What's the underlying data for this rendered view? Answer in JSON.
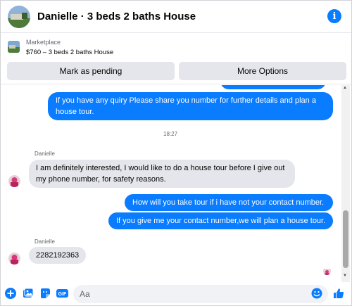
{
  "header": {
    "title": "Danielle · 3 beds 2 baths House",
    "info_icon": "info-icon"
  },
  "marketplace": {
    "label": "Marketplace",
    "item": "$760 – 3 beds 2 baths House",
    "buttons": {
      "pending": "Mark as pending",
      "more": "More Options"
    }
  },
  "messages": {
    "out_1": "If you have any quiry Please share you number for further details and plan a house tour.",
    "timestamp": "18:27",
    "sender_1": "Danielle",
    "in_1": "I am definitely interested, I would like to do a house tour before I give out my phone number, for safety reasons.",
    "out_2": "How will you take tour if i have not your contact number.",
    "out_3": "If you give me your contact number,we will plan a house tour.",
    "sender_2": "Danielle",
    "in_2": "2282192363"
  },
  "composer": {
    "placeholder": "Aa",
    "gif_label": "GIF"
  },
  "colors": {
    "accent": "#0a7cff",
    "bubble_in": "#e4e6eb"
  }
}
